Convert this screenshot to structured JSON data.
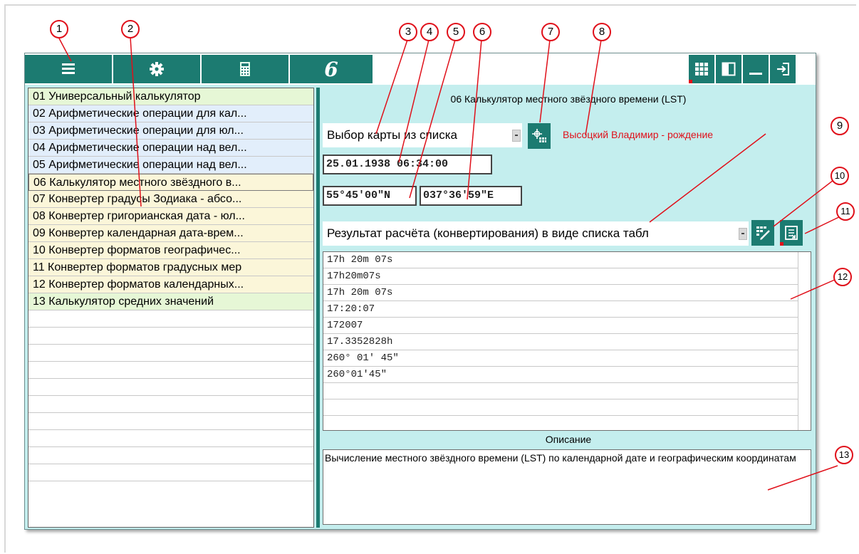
{
  "toolbar": {
    "menu_icon": "hamburger-icon",
    "settings_icon": "gear-icon",
    "calculator_icon": "calculator-icon",
    "logo_glyph": "6",
    "grid_icon": "grid-icon",
    "panel_icon": "panel-icon",
    "minimize_icon": "minimize-icon",
    "exit_icon": "exit-icon"
  },
  "colors": {
    "toolbar": "#1c7b71",
    "background": "#c4eeee",
    "annotation": "#e0101a",
    "row_green": "#e6f7d6",
    "row_blue": "#e2eefb",
    "row_yellow": "#fbf6d9"
  },
  "sidebar": {
    "items": [
      {
        "label": "01 Универсальный калькулятор",
        "tint": "green"
      },
      {
        "label": "02 Арифметические операции для кал...",
        "tint": "blue"
      },
      {
        "label": "03 Арифметические операции для юл...",
        "tint": "blue"
      },
      {
        "label": "04 Арифметические операции над вел...",
        "tint": "blue"
      },
      {
        "label": "05 Арифметические операции над вел...",
        "tint": "blue"
      },
      {
        "label": "06 Калькулятор местного звёздного в...",
        "tint": "yellow"
      },
      {
        "label": "07 Конвертер градусы Зодиака - абсо...",
        "tint": "yellow"
      },
      {
        "label": "08 Конвертер григорианская дата - юл...",
        "tint": "yellow"
      },
      {
        "label": "09 Конвертер календарная дата-врем...",
        "tint": "yellow"
      },
      {
        "label": "10 Конвертер форматов географичес...",
        "tint": "yellow"
      },
      {
        "label": "11 Конвертер форматов градусных мер",
        "tint": "yellow"
      },
      {
        "label": "12 Конвертер форматов календарных...",
        "tint": "yellow"
      },
      {
        "label": "13 Калькулятор средних значений",
        "tint": "green"
      }
    ],
    "empty_rows": 10
  },
  "main": {
    "title": "06 Калькулятор местного звёздного времени (LST)",
    "map_select": "Выбор карты из списка",
    "person": "Высоцкий Владимир - рождение",
    "datetime": "25.01.1938 06:34:00",
    "latitude": "55°45'00\"N",
    "longitude": "037°36'59\"E",
    "result_select": "Результат расчёта (конвертирования) в виде списка табл",
    "results": [
      "17h 20m 07s",
      "17h20m07s",
      "17h 20m 07s",
      "17:20:07",
      "172007",
      "17.3352828h",
      "260° 01' 45\"",
      "260°01'45\""
    ],
    "results_empty_rows": 2,
    "description_title": "Описание",
    "description": "Вычисление местного звёздного времени (LST) по календарной дате и географическим координатам"
  },
  "annotations": [
    "1",
    "2",
    "3",
    "4",
    "5",
    "6",
    "7",
    "8",
    "9",
    "10",
    "11",
    "12",
    "13"
  ]
}
